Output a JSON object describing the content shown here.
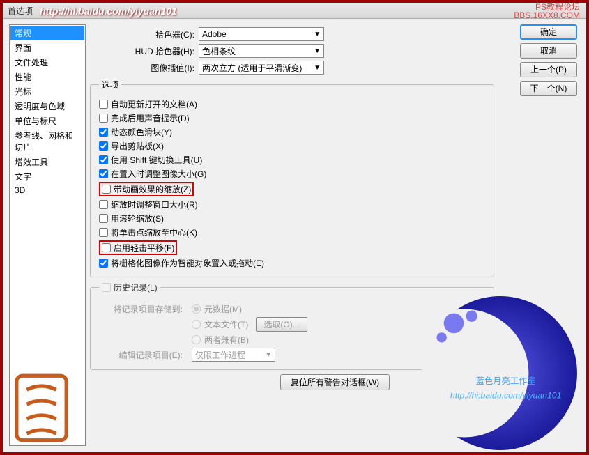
{
  "window": {
    "title": "首选项",
    "url": "http://hi.baidu.com/yiyuan101",
    "forum_line1": "PS教程论坛",
    "forum_line2": "BBS.16XX8.COM"
  },
  "sidebar": {
    "items": [
      "常规",
      "界面",
      "文件处理",
      "性能",
      "光标",
      "透明度与色域",
      "单位与标尺",
      "参考线、网格和切片",
      "增效工具",
      "文字",
      "3D"
    ]
  },
  "buttons": {
    "ok": "确定",
    "cancel": "取消",
    "prev": "上一个(P)",
    "next": "下一个(N)"
  },
  "pickers": {
    "color_label": "拾色器(C):",
    "color_value": "Adobe",
    "hud_label": "HUD 拾色器(H):",
    "hud_value": "色相条纹",
    "interp_label": "图像插值(I):",
    "interp_value": "两次立方 (适用于平滑渐变)"
  },
  "options": {
    "legend": "选项",
    "items": [
      {
        "label": "自动更新打开的文档(A)",
        "checked": false,
        "hl": false
      },
      {
        "label": "完成后用声音提示(D)",
        "checked": false,
        "hl": false
      },
      {
        "label": "动态颜色滑块(Y)",
        "checked": true,
        "hl": false
      },
      {
        "label": "导出剪贴板(X)",
        "checked": true,
        "hl": false
      },
      {
        "label": "使用 Shift 键切换工具(U)",
        "checked": true,
        "hl": false
      },
      {
        "label": "在置入时调整图像大小(G)",
        "checked": true,
        "hl": false
      },
      {
        "label": "带动画效果的缩放(Z)",
        "checked": false,
        "hl": true
      },
      {
        "label": "缩放时调整窗口大小(R)",
        "checked": false,
        "hl": false
      },
      {
        "label": "用滚轮缩放(S)",
        "checked": false,
        "hl": false
      },
      {
        "label": "将单击点缩放至中心(K)",
        "checked": false,
        "hl": false
      },
      {
        "label": "启用轻击平移(F)",
        "checked": false,
        "hl": true
      },
      {
        "label": "将栅格化图像作为智能对象置入或拖动(E)",
        "checked": true,
        "hl": false
      }
    ]
  },
  "history": {
    "legend": "历史记录(L)",
    "store_label": "将记录项目存储到:",
    "r1": "元数据(M)",
    "r2": "文本文件(T)",
    "choose": "选取(O)...",
    "r3": "两者兼有(B)",
    "edit_label": "编辑记录项目(E):",
    "edit_value": "仅限工作进程"
  },
  "reset": "复位所有警告对话框(W)",
  "watermark": {
    "studio": "蓝色月亮工作室",
    "url": "http://hi.baidu.com/yiyuan101"
  }
}
